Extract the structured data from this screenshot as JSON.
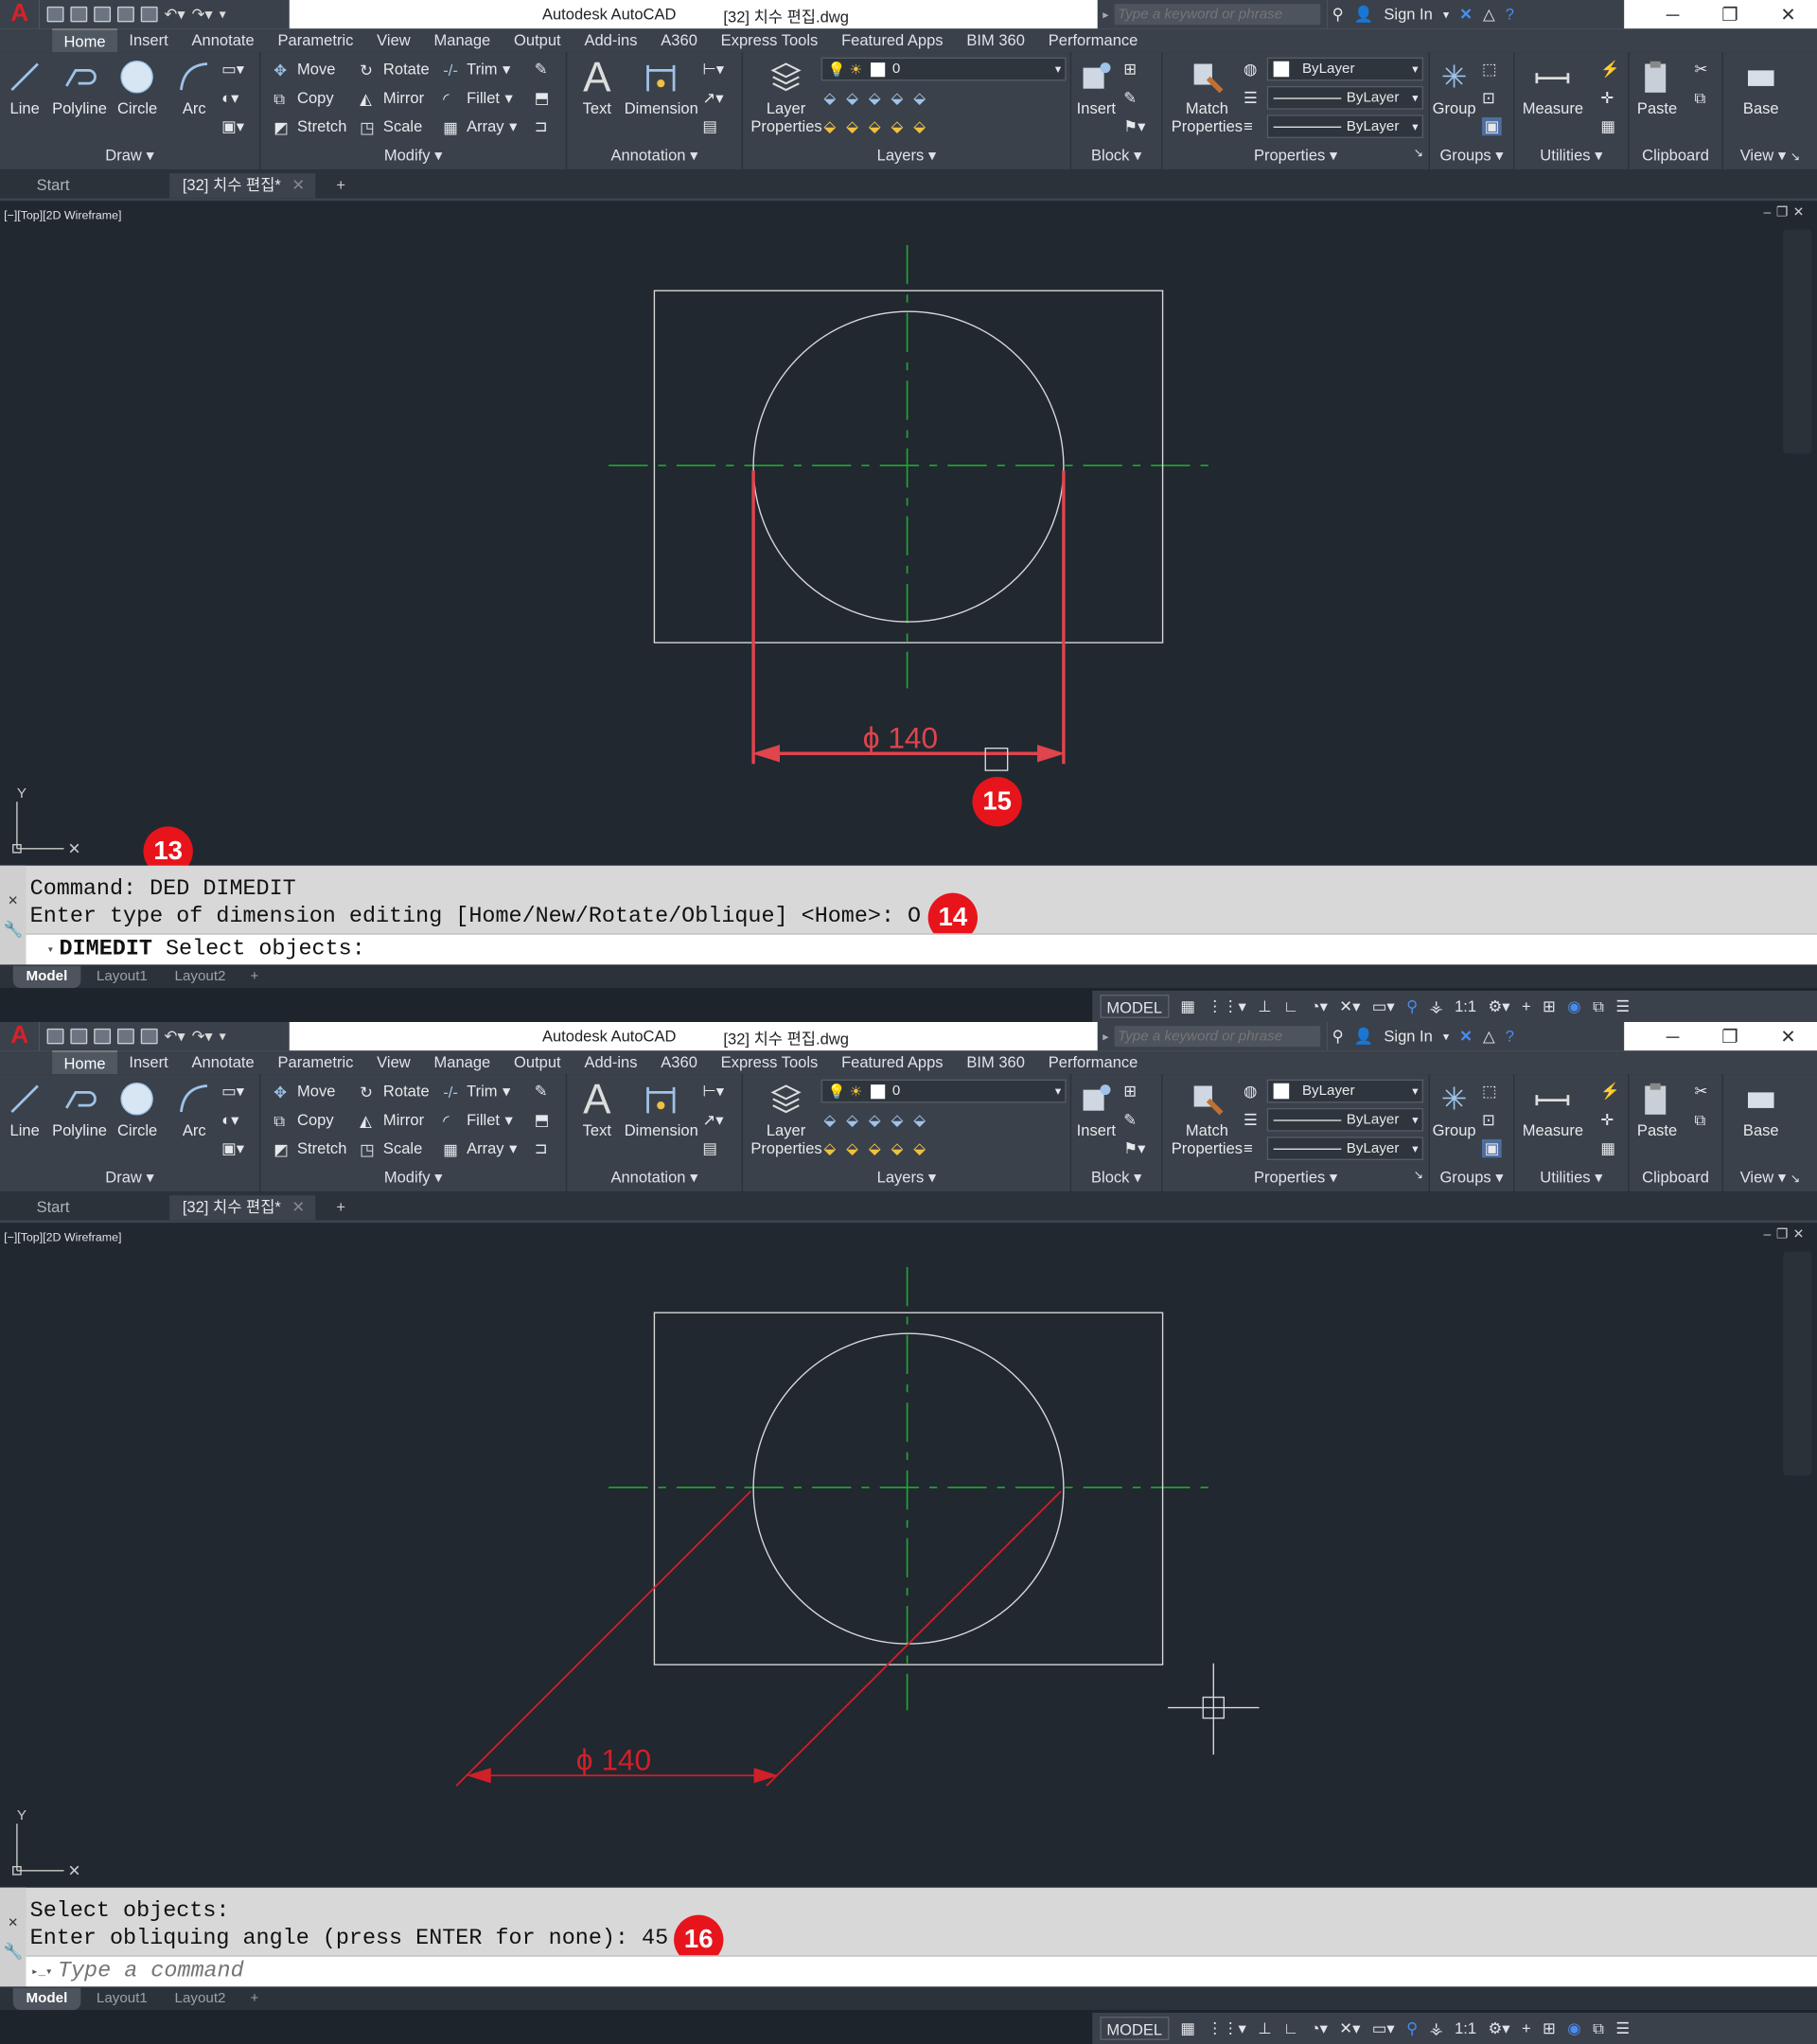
{
  "app": {
    "title": "Autodesk AutoCAD",
    "file": "[32] 치수 편집.dwg",
    "logo": "A",
    "search_placeholder": "Type a keyword or phrase",
    "sign_in": "Sign In"
  },
  "menu_tabs": [
    "Home",
    "Insert",
    "Annotate",
    "Parametric",
    "View",
    "Manage",
    "Output",
    "Add-ins",
    "A360",
    "Express Tools",
    "Featured Apps",
    "BIM 360",
    "Performance"
  ],
  "ribbon": {
    "draw": {
      "line": "Line",
      "polyline": "Polyline",
      "circle": "Circle",
      "arc": "Arc",
      "title": "Draw"
    },
    "modify": {
      "move": "Move",
      "rotate": "Rotate",
      "trim": "Trim",
      "copy": "Copy",
      "mirror": "Mirror",
      "fillet": "Fillet",
      "stretch": "Stretch",
      "scale": "Scale",
      "array": "Array",
      "title": "Modify"
    },
    "annotation": {
      "text": "Text",
      "dimension": "Dimension",
      "title": "Annotation"
    },
    "layers": {
      "layer_properties": "Layer Properties",
      "layer_name": "0",
      "title": "Layers"
    },
    "block": {
      "insert": "Insert",
      "title": "Block"
    },
    "properties": {
      "match": "Match Properties",
      "color": "ByLayer",
      "linetype": "ByLayer",
      "lineweight": "ByLayer",
      "title": "Properties"
    },
    "groups": {
      "group": "Group",
      "title": "Groups"
    },
    "utilities": {
      "measure": "Measure",
      "title": "Utilities"
    },
    "clipboard": {
      "paste": "Paste",
      "title": "Clipboard"
    },
    "view": {
      "base": "Base",
      "title": "View"
    }
  },
  "doc_tabs": {
    "start": "Start",
    "active": "[32] 치수 편집*"
  },
  "viewport_label": "[−][Top][2D Wireframe]",
  "layout_tabs": [
    "Model",
    "Layout1",
    "Layout2"
  ],
  "status": {
    "model": "MODEL",
    "scale": "1:1"
  },
  "colors": {
    "accent": "#e8141c",
    "dimension": "#e0444c",
    "centerline": "#1fa82f",
    "geometry": "#d8d8d8"
  },
  "screens": [
    {
      "dimension_text": "ϕ 140",
      "cmd_lines": [
        "Command: DED DIMEDIT",
        "Enter type of dimension editing [Home/New/Rotate/Oblique] <Home>: O"
      ],
      "cmd_prompt_name": "DIMEDIT",
      "cmd_prompt_text": "Select objects:",
      "markers": [
        "13",
        "14",
        "15"
      ]
    },
    {
      "dimension_text": "ϕ 140",
      "cmd_lines": [
        "Select objects:",
        "Enter obliquing angle (press ENTER for none): 45"
      ],
      "cmd_placeholder": "Type a command",
      "markers": [
        "16"
      ]
    }
  ]
}
